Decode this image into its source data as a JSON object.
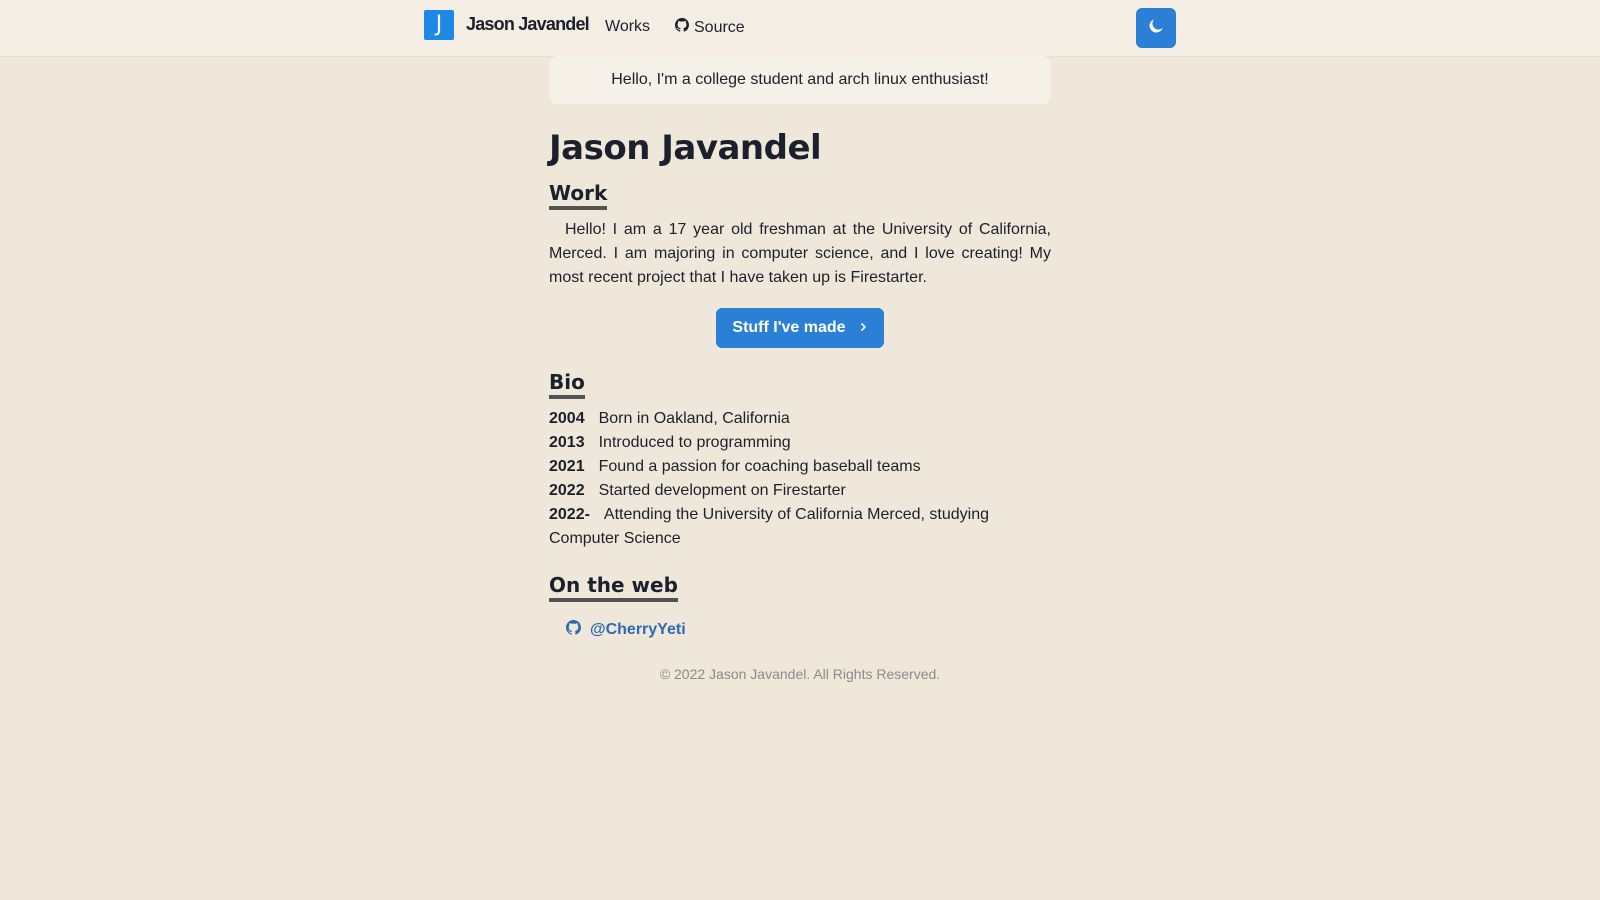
{
  "navbar": {
    "logo_letter": "J",
    "brand": "Jason Javandel",
    "links": [
      {
        "label": "Works"
      },
      {
        "label": "Source",
        "icon": "github-icon"
      }
    ],
    "theme_toggle_icon": "moon-icon"
  },
  "greeting": "Hello, I'm a college student and arch linux enthusiast!",
  "title": "Jason Javandel",
  "work": {
    "heading": "Work",
    "text": "Hello! I am a 17 year old freshman at the University of California, Merced. I am majoring in computer science, and I love creating! My most recent project that I have taken up is Firestarter.",
    "button_label": "Stuff I've made",
    "button_icon": "chevron-right-icon"
  },
  "bio": {
    "heading": "Bio",
    "items": [
      {
        "year": "2004",
        "text": "Born in Oakland, California"
      },
      {
        "year": "2013",
        "text": "Introduced to programming"
      },
      {
        "year": "2021",
        "text": "Found a passion for coaching baseball teams"
      },
      {
        "year": "2022",
        "text": "Started development on Firestarter"
      },
      {
        "year": "2022-",
        "text": "Attending the University of California Merced, studying Computer Science"
      }
    ]
  },
  "web": {
    "heading": "On the web",
    "links": [
      {
        "label": "@CherryYeti",
        "icon": "github-icon"
      }
    ]
  },
  "footer": "© 2022 Jason Javandel. All Rights Reserved.",
  "colors": {
    "accent": "#2b7fd4",
    "logo": "#1e88e5",
    "background": "#f0e7db",
    "link": "#2b6cb0"
  }
}
